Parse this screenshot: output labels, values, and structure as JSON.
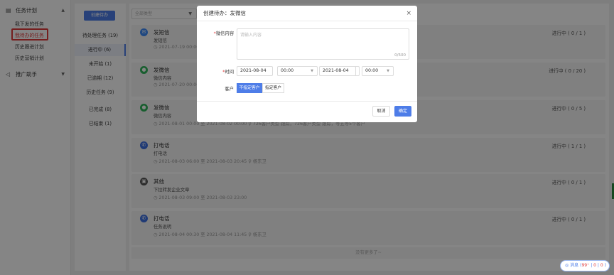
{
  "sidebar": {
    "group1": {
      "label": "任务计划",
      "icon": "calendar-icon"
    },
    "items": [
      {
        "label": "我下发的任务"
      },
      {
        "label": "我待办的任务"
      },
      {
        "label": "历史跟进计划"
      },
      {
        "label": "历史营销计划"
      }
    ],
    "group2": {
      "label": "推广助手",
      "icon": "megaphone-icon"
    }
  },
  "statuses": {
    "create_button": "创建待办",
    "items": [
      {
        "label": "待处理任务 (19)"
      },
      {
        "label": "进行中 (6)"
      },
      {
        "label": "未开始 (1)"
      },
      {
        "label": "已逾期 (12)"
      },
      {
        "label": "历史任务 (9)"
      },
      {
        "label": "已完成 (8)"
      },
      {
        "label": "已结束 (1)"
      }
    ]
  },
  "filter": {
    "placeholder": "全部类型"
  },
  "tasks": [
    {
      "icon": "wechat-icon",
      "icon_color": "#3d8af7",
      "title": "发短信",
      "sub": "发短信",
      "meta": "◷ 2021-07-19 00:00",
      "status": "进行中 ( 0 / 1 )"
    },
    {
      "icon": "wechat-icon",
      "icon_color": "#2fb55a",
      "title": "发微信",
      "sub": "微信内容",
      "meta": "◷ 2021-07-20 00:00",
      "status": "进行中 ( 0 / 20 )"
    },
    {
      "icon": "wechat-icon",
      "icon_color": "#2fb55a",
      "title": "发微信",
      "sub": "微信内容",
      "meta": "◷ 2021-08-01 00:00 至 2021-08-02 00:00    ♀ 726客户类型 跟踪，726客户类型 跟踪，等五等5个客户",
      "status": "进行中 ( 0 / 5 )"
    },
    {
      "icon": "phone-icon",
      "icon_color": "#3d6fe0",
      "title": "打电话",
      "sub": "打电话",
      "meta": "◷ 2021-08-03 06:00 至 2021-08-03 20:45    ♀ 杨东卫",
      "status": "进行中 ( 1 / 1 )"
    },
    {
      "icon": "other-icon",
      "icon_color": "#555555",
      "title": "其他",
      "sub": "下拉转发企业文章",
      "meta": "◷ 2021-08-03 09:00 至 2021-08-03 23:00",
      "status": "进行中 ( 0 / 1 )"
    },
    {
      "icon": "phone-icon",
      "icon_color": "#3d6fe0",
      "title": "打电话",
      "sub": "任务说明",
      "meta": "◷ 2021-08-04 00:30 至 2021-08-04 11:45    ♀ 杨东卫",
      "status": "进行中 ( 0 / 1 )"
    }
  ],
  "no_more": "没有更多了~",
  "modal": {
    "title": "创建待办：发微信",
    "close": "×",
    "content_label": "微信内容",
    "content_placeholder": "请输入内容",
    "counter": "0/500",
    "time_label": "时间",
    "start_date": "2021-08-04",
    "start_time": "00:00",
    "tilde": "~",
    "end_date": "2021-08-04",
    "end_time": "00:00",
    "customer_label": "客户",
    "seg_unlimited": "不指定客户",
    "seg_specific": "指定客户",
    "cancel": "取消",
    "confirm": "确定"
  },
  "badge": {
    "label": "消息",
    "count": "99⁺",
    "sep": "|",
    "a": "0",
    "b": "0"
  }
}
